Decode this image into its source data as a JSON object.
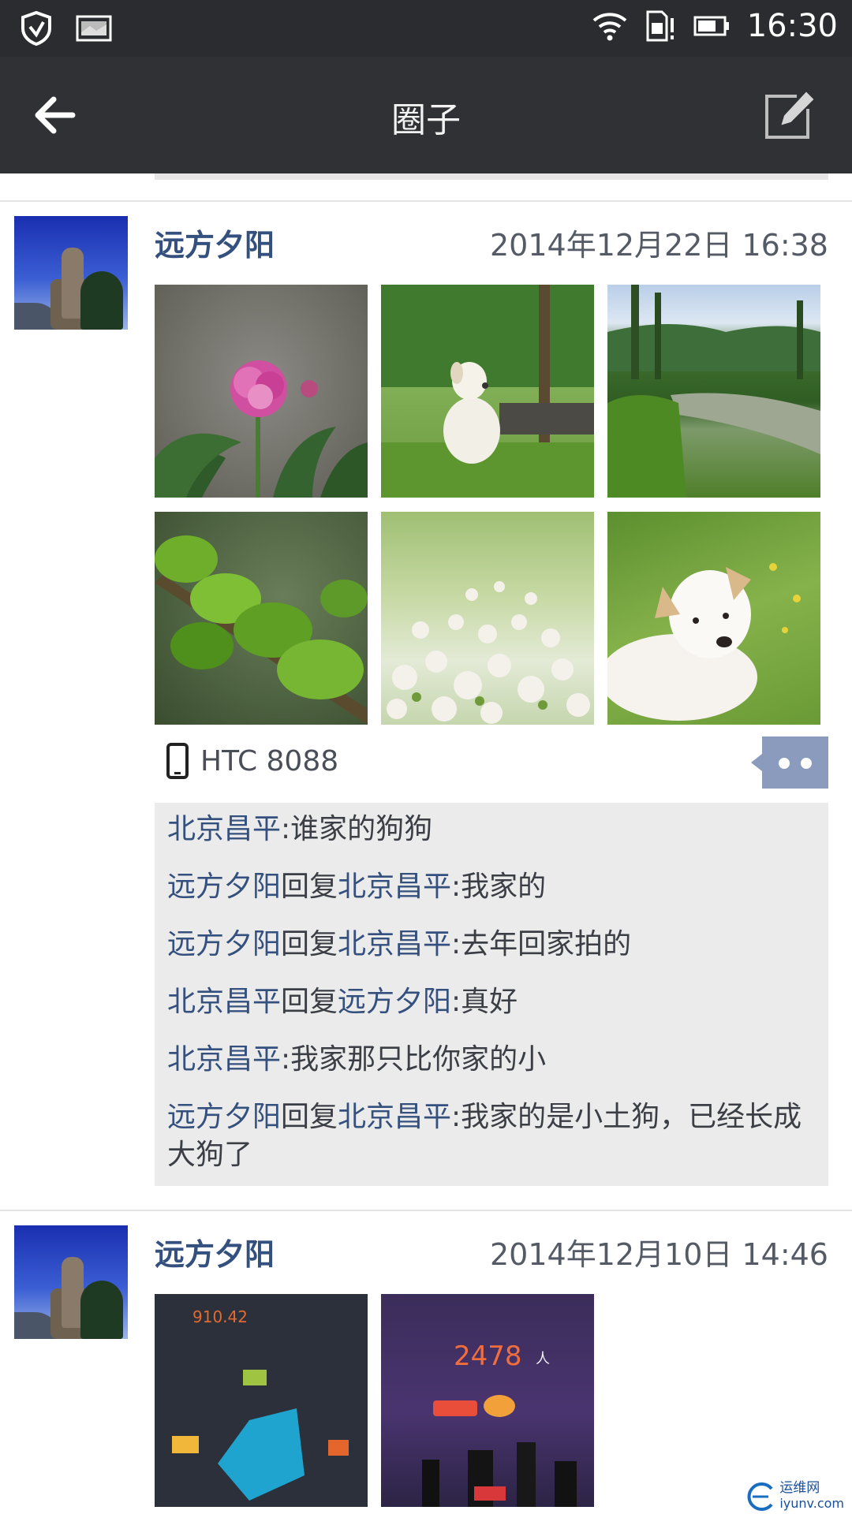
{
  "status_bar": {
    "time": "16:30"
  },
  "app_bar": {
    "title": "圈子"
  },
  "posts": [
    {
      "username": "远方夕阳",
      "timestamp": "2014年12月22日 16:38",
      "device": "HTC 8088",
      "photos": [
        "peony-flower",
        "white-dog-on-grass",
        "mountain-river",
        "green-leaves",
        "white-clover-field",
        "white-dog-lying"
      ],
      "comments": [
        {
          "from": "北京昌平",
          "reply_word": "",
          "to": "",
          "text": ":谁家的狗狗"
        },
        {
          "from": "远方夕阳",
          "reply_word": "回复",
          "to": "北京昌平",
          "text": ":我家的"
        },
        {
          "from": "远方夕阳",
          "reply_word": "回复",
          "to": "北京昌平",
          "text": ":去年回家拍的"
        },
        {
          "from": "北京昌平",
          "reply_word": "回复",
          "to": "远方夕阳",
          "text": ":真好"
        },
        {
          "from": "北京昌平",
          "reply_word": "",
          "to": "",
          "text": ":我家那只比你家的小"
        },
        {
          "from": "远方夕阳",
          "reply_word": "回复",
          "to": "北京昌平",
          "text": ":我家的是小土狗，已经长成大狗了"
        }
      ]
    },
    {
      "username": "远方夕阳",
      "timestamp": "2014年12月10日 14:46",
      "photos": [
        "app-chart-screenshot",
        "app-city-screenshot"
      ],
      "photo_text": {
        "app1_number": "910.42",
        "app2_number": "2478",
        "app2_unit": "人"
      }
    }
  ],
  "watermark": {
    "cn": "运维网",
    "en": "iyunv.com"
  },
  "colors": {
    "app_bar": "#2f3134",
    "status_bar": "#2a2c2f",
    "name_blue": "#34507e",
    "comment_bg": "#ebebeb",
    "bubble": "#8a9bbd"
  }
}
